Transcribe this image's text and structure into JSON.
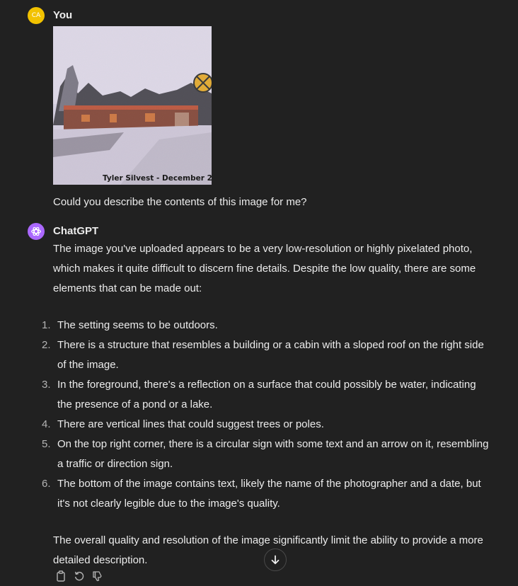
{
  "user_message": {
    "author": "You",
    "avatar_initials": "CA",
    "avatar_color": "#f2c200",
    "image_caption": "Tyler Silvest - December 2",
    "text": "Could you describe the contents of this image for me?"
  },
  "assistant_message": {
    "author": "ChatGPT",
    "avatar_color": "#ab68ff",
    "avatar_icon": "openai-logo-icon",
    "intro": "The image you've uploaded appears to be a very low-resolution or highly pixelated photo, which makes it quite difficult to discern fine details. Despite the low quality, there are some elements that can be made out:",
    "points": [
      {
        "num": "1.",
        "text": "The setting seems to be outdoors."
      },
      {
        "num": "2.",
        "text": "There is a structure that resembles a building or a cabin with a sloped roof on the right side of the image."
      },
      {
        "num": "3.",
        "text": "In the foreground, there's a reflection on a surface that could possibly be water, indicating the presence of a pond or a lake."
      },
      {
        "num": "4.",
        "text": "There are vertical lines that could suggest trees or poles."
      },
      {
        "num": "5.",
        "text": "On the top right corner, there is a circular sign with some text and an arrow on it, resembling a traffic or direction sign."
      },
      {
        "num": "6.",
        "text": "The bottom of the image contains text, likely the name of the photographer and a date, but it's not clearly legible due to the image's quality."
      }
    ],
    "outro": "The overall quality and resolution of the image significantly limit the ability to provide a more detailed description."
  },
  "toolbar": {
    "icons": [
      "copy-icon",
      "regenerate-icon",
      "thumbs-down-icon"
    ]
  },
  "scroll_button": {
    "icon": "arrow-down-icon"
  },
  "colors": {
    "background": "#212121",
    "text": "#ececec",
    "muted": "#b4b4b4"
  }
}
